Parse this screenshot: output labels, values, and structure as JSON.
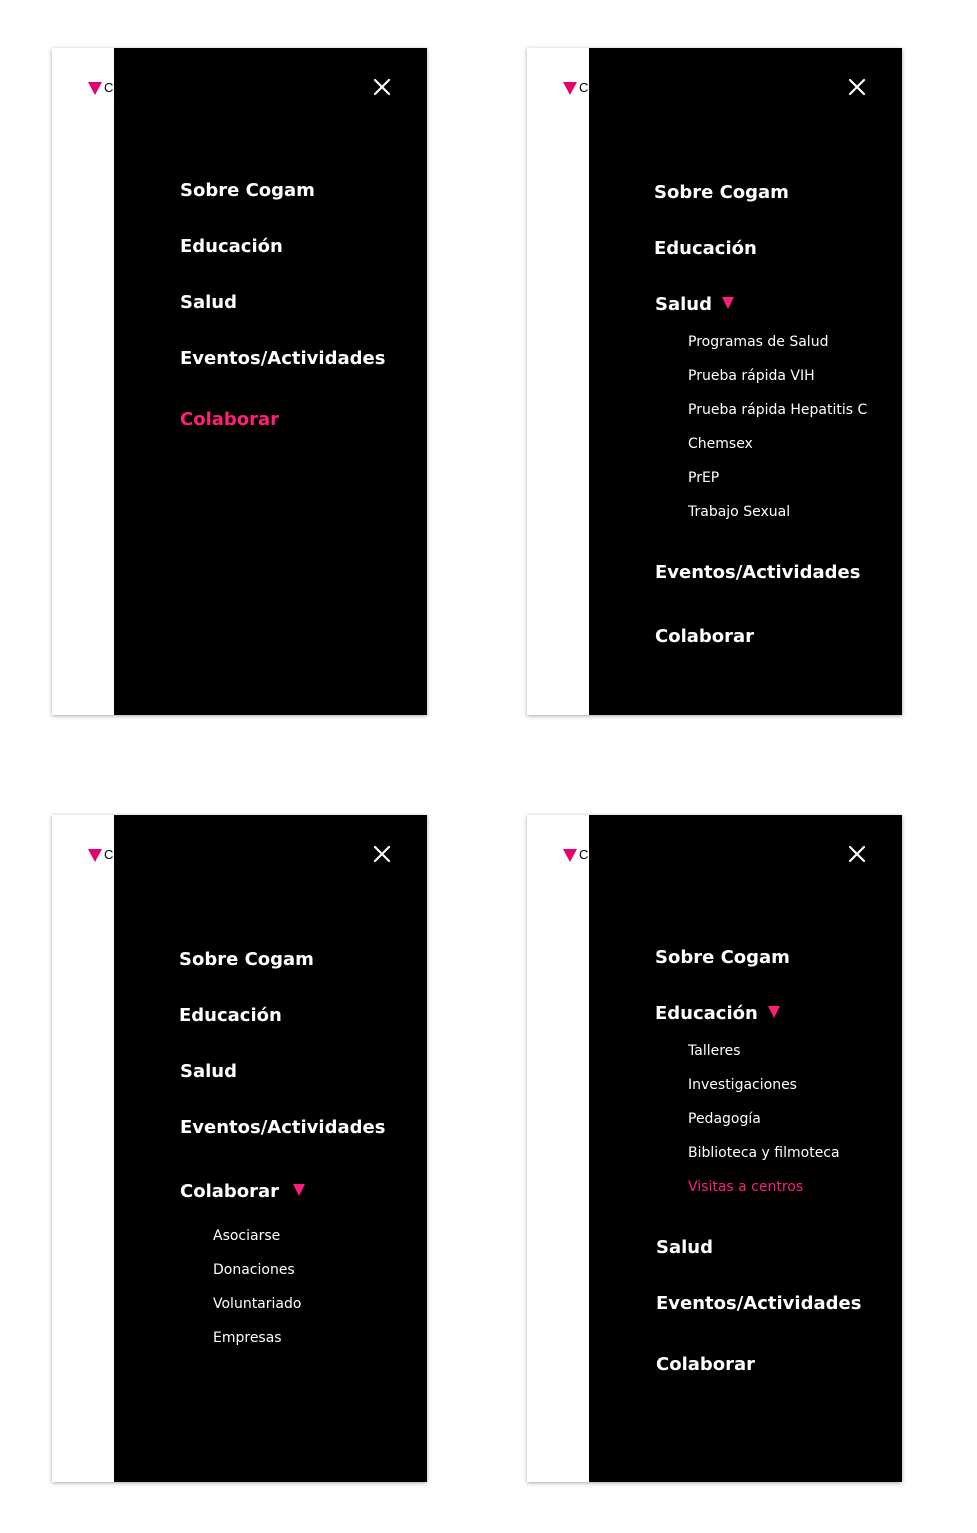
{
  "brand": {
    "logo_letter": "C",
    "accent_color": "#ff1f7a"
  },
  "close_icon": "close-icon",
  "screens": [
    {
      "menu": [
        {
          "label": "Sobre Cogam"
        },
        {
          "label": "Educación"
        },
        {
          "label": "Salud"
        },
        {
          "label": "Eventos/Actividades"
        },
        {
          "label": "Colaborar",
          "active": true
        }
      ]
    },
    {
      "menu": [
        {
          "label": "Sobre Cogam"
        },
        {
          "label": "Educación"
        },
        {
          "label": "Salud",
          "expanded": true,
          "submenu": [
            "Programas de Salud",
            "Prueba rápida VIH",
            "Prueba rápida Hepatitis C",
            "Chemsex",
            "PrEP",
            "Trabajo Sexual"
          ]
        },
        {
          "label": "Eventos/Actividades"
        },
        {
          "label": "Colaborar"
        }
      ]
    },
    {
      "menu": [
        {
          "label": "Sobre Cogam"
        },
        {
          "label": "Educación"
        },
        {
          "label": "Salud"
        },
        {
          "label": "Eventos/Actividades"
        },
        {
          "label": "Colaborar",
          "expanded": true,
          "submenu": [
            "Asociarse",
            "Donaciones",
            "Voluntariado",
            "Empresas"
          ]
        }
      ]
    },
    {
      "menu": [
        {
          "label": "Sobre Cogam"
        },
        {
          "label": "Educación",
          "expanded": true,
          "submenu": [
            "Talleres",
            "Investigaciones",
            "Pedagogía",
            "Biblioteca y filmoteca",
            "Visitas a centros"
          ],
          "active_sub": "Visitas a centros"
        },
        {
          "label": "Salud"
        },
        {
          "label": "Eventos/Actividades"
        },
        {
          "label": "Colaborar"
        }
      ]
    }
  ]
}
